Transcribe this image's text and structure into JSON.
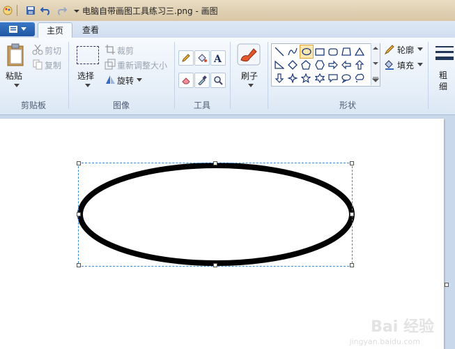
{
  "window": {
    "title": "电脑自带画图工具练习三.png - 画图"
  },
  "tabs": [
    {
      "label": "主页"
    },
    {
      "label": "查看"
    }
  ],
  "clipboard": {
    "paste": "粘贴",
    "cut": "剪切",
    "copy": "复制",
    "group_label": "剪贴板"
  },
  "image": {
    "select": "选择",
    "crop": "裁剪",
    "resize": "重新调整大小",
    "rotate": "旋转",
    "group_label": "图像"
  },
  "tools": {
    "group_label": "工具"
  },
  "brushes": {
    "label": "刷子"
  },
  "shapes": {
    "outline": "轮廓",
    "fill": "填充",
    "group_label": "形状"
  },
  "size": {
    "label": "粗细"
  },
  "watermark": {
    "text": "Bai 经验",
    "url": "jingyan.baidu.com"
  },
  "colors": {
    "accent": "#1f56a3",
    "selection": "#3a8ad8",
    "stroke": "#000000"
  }
}
